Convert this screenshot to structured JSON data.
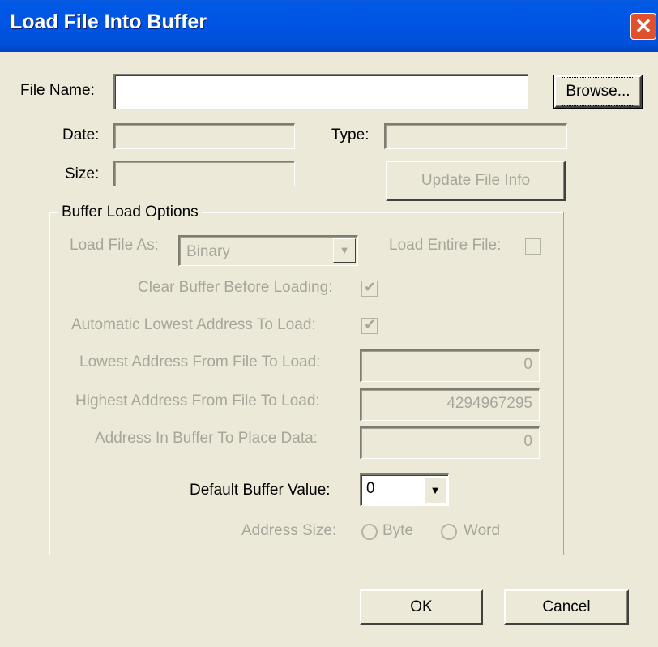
{
  "window": {
    "title": "Load File Into Buffer",
    "close_glyph": "✕"
  },
  "file": {
    "name_label": "File Name:",
    "name_value": "",
    "browse_label": "Browse...",
    "date_label": "Date:",
    "date_value": "",
    "type_label": "Type:",
    "type_value": "",
    "size_label": "Size:",
    "size_value": "",
    "update_label": "Update File Info"
  },
  "options": {
    "group_title": "Buffer Load Options",
    "load_as_label": "Load File As:",
    "load_as_value": "Binary",
    "load_entire_label": "Load Entire File:",
    "load_entire_checked": false,
    "clear_buffer_label": "Clear Buffer Before Loading:",
    "clear_buffer_checked": true,
    "auto_lowest_label": "Automatic Lowest Address To Load:",
    "auto_lowest_checked": true,
    "lowest_label": "Lowest Address From File To Load:",
    "lowest_value": "0",
    "highest_label": "Highest Address From File To Load:",
    "highest_value": "4294967295",
    "place_label": "Address In Buffer To Place Data:",
    "place_value": "0",
    "default_value_label": "Default Buffer Value:",
    "default_value": "0",
    "address_size_label": "Address Size:",
    "byte_label": "Byte",
    "word_label": "Word"
  },
  "actions": {
    "ok_label": "OK",
    "cancel_label": "Cancel"
  }
}
